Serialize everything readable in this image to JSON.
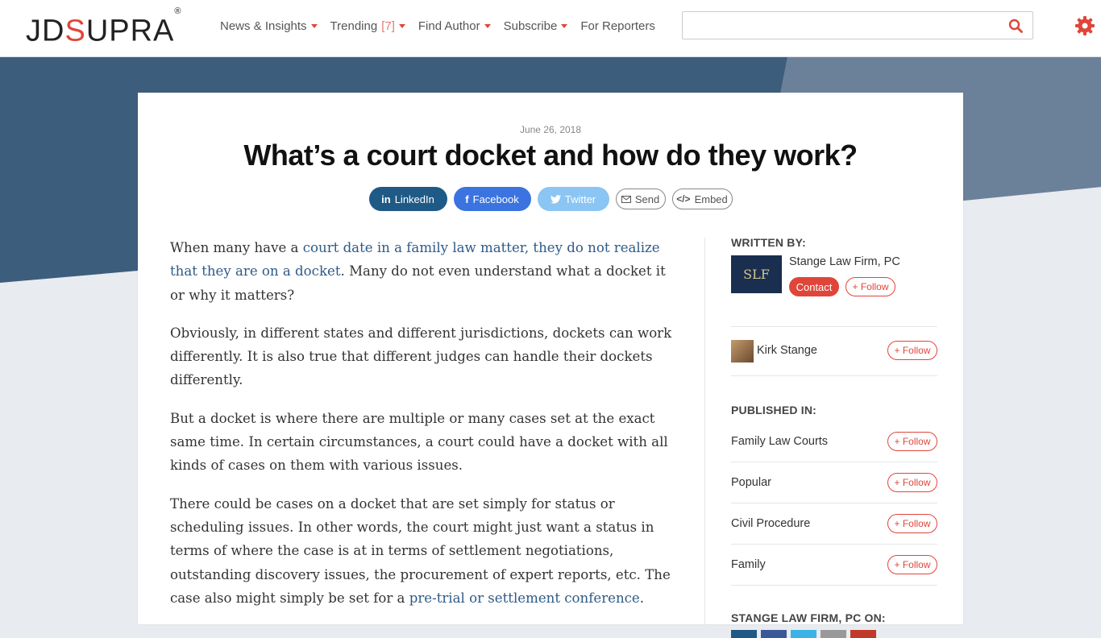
{
  "header": {
    "logo_prefix": "JD",
    "logo_s": "S",
    "logo_suffix": "UPRA",
    "logo_reg": "®",
    "nav": [
      {
        "label": "News & Insights"
      },
      {
        "label": "Trending",
        "count": "[7]"
      },
      {
        "label": "Find Author"
      },
      {
        "label": "Subscribe"
      },
      {
        "label": "For Reporters"
      }
    ],
    "search_placeholder": ""
  },
  "colors": {
    "accent": "#e0453a",
    "hero_dark": "#3d5d7d",
    "hero_light": "#6b8199",
    "link": "#2e5a87"
  },
  "article": {
    "date": "June 26, 2018",
    "title": "What’s a court docket and how do they work?",
    "share": {
      "linkedin": "LinkedIn",
      "facebook": "Facebook",
      "twitter": "Twitter",
      "send": "Send",
      "embed": "Embed"
    },
    "p1_a": "When many have a ",
    "p1_link": "court date in a family law matter, they do not realize that they are on a docket",
    "p1_b": ". Many do not even understand what a docket it or why it matters?",
    "p2": "Obviously, in different states and different jurisdictions, dockets can work differently. It is also true that different judges can handle their dockets differently.",
    "p3": "But a docket is where there are multiple or many cases set at the exact same time. In certain circumstances, a court could have a docket with all kinds of cases on them with various issues.",
    "p4_a": "There could be cases on a docket that are set simply for status or scheduling issues. In other words, the court might just want a status in terms of where the case is at in terms of settlement negotiations, outstanding discovery issues, the procurement of expert reports, etc. The case also might simply be set for a ",
    "p4_link": "pre-trial or settlement conference",
    "p4_b": "."
  },
  "sidebar": {
    "written_by": "WRITTEN BY:",
    "firm_name": "Stange Law Firm, PC",
    "firm_logo_text": "SLF",
    "contact": "Contact",
    "follow": "+ Follow",
    "person_name": "Kirk Stange",
    "published_in": "PUBLISHED IN:",
    "topics": [
      "Family Law Courts",
      "Popular",
      "Civil Procedure",
      "Family"
    ],
    "on_label": "STANGE LAW FIRM, PC ON:"
  }
}
